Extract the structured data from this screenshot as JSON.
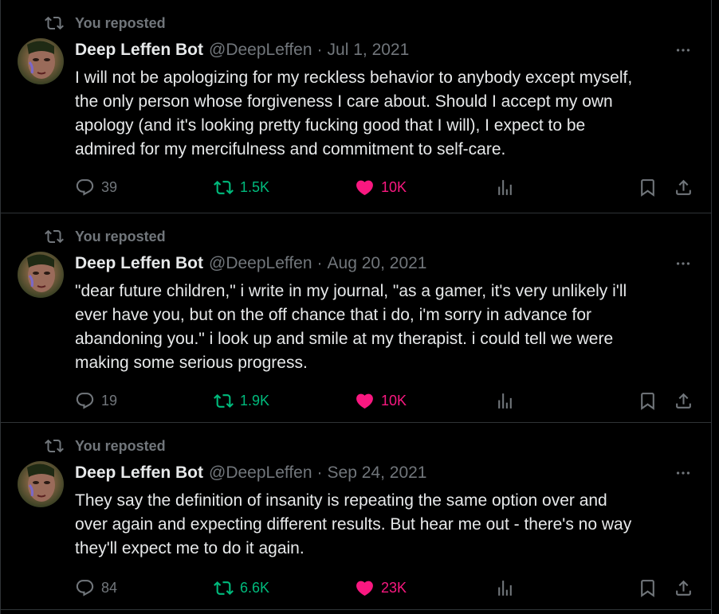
{
  "theme": {
    "background": "#000000",
    "text_primary": "#e7e9ea",
    "text_secondary": "#71767b",
    "retweet_color": "#00ba7c",
    "like_color": "#f91880",
    "border": "#2f3336"
  },
  "icons": {
    "repost": "repost-icon",
    "reply": "reply-icon",
    "retweet": "retweet-icon",
    "like": "heart-filled-icon",
    "views": "views-bar-icon",
    "bookmark": "bookmark-icon",
    "share": "share-icon",
    "more": "more-dots-icon"
  },
  "tweets": [
    {
      "repost_label": "You reposted",
      "author_name": "Deep Leffen Bot",
      "author_handle": "@DeepLeffen",
      "separator": "·",
      "date": "Jul 1, 2021",
      "text": "I will not be apologizing for my reckless behavior to anybody except myself,\nthe only person whose forgiveness I care about. Should I accept my own\napology (and it's looking pretty fucking good that I will), I expect to be\nadmired for my mercifulness and commitment to self-care.",
      "reply_count": "39",
      "retweet_count": "1.5K",
      "like_count": "10K"
    },
    {
      "repost_label": "You reposted",
      "author_name": "Deep Leffen Bot",
      "author_handle": "@DeepLeffen",
      "separator": "·",
      "date": "Aug 20, 2021",
      "text": "\"dear future children,\" i write in my journal, \"as a gamer, it's very unlikely i'll\never have you, but on the off chance that i do, i'm sorry in advance for\nabandoning you.\" i look up and smile at my therapist. i could tell we were\nmaking some serious progress.",
      "reply_count": "19",
      "retweet_count": "1.9K",
      "like_count": "10K"
    },
    {
      "repost_label": "You reposted",
      "author_name": "Deep Leffen Bot",
      "author_handle": "@DeepLeffen",
      "separator": "·",
      "date": "Sep 24, 2021",
      "text": "They say the definition of insanity is repeating the same option over and\nover again and expecting different results. But hear me out - there's no way\nthey'll expect me to do it again.",
      "reply_count": "84",
      "retweet_count": "6.6K",
      "like_count": "23K"
    }
  ]
}
